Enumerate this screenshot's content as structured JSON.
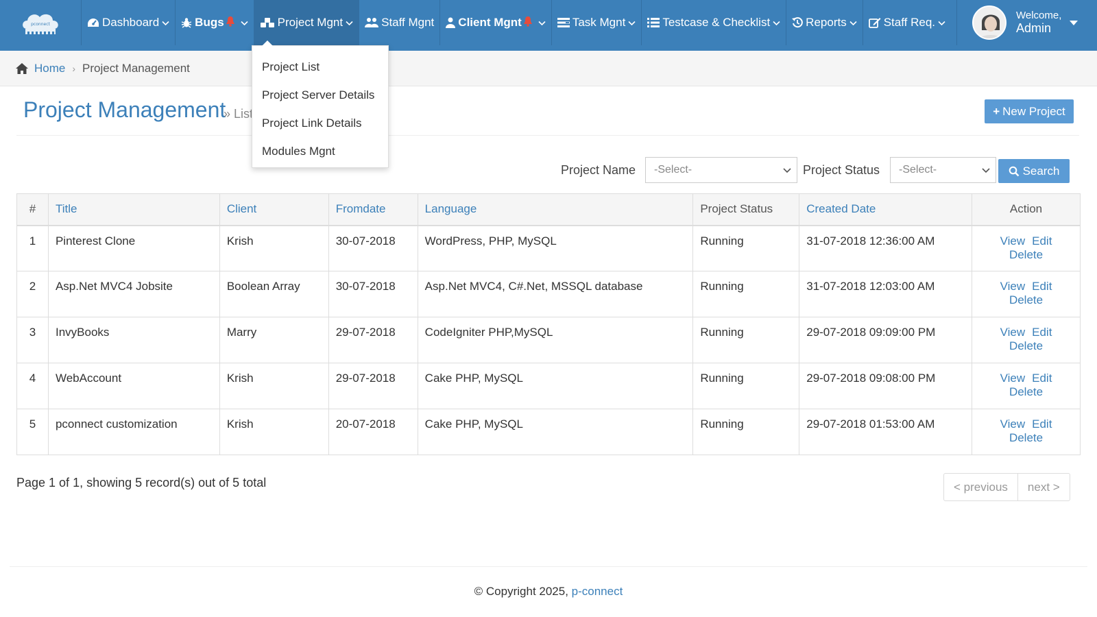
{
  "colors": {
    "navbar": "#3c80b9",
    "accent": "#5b9bd5",
    "link": "#3c80b9",
    "alert": "#e74c3c"
  },
  "nav": {
    "items": [
      {
        "label": "Dashboard",
        "icon": "dashboard-icon"
      },
      {
        "label": "Bugs",
        "icon": "bug-icon",
        "alert": true
      },
      {
        "label": "Project Mgnt",
        "icon": "cubes-icon",
        "active": true
      },
      {
        "label": "Staff Mgnt",
        "icon": "users-icon"
      },
      {
        "label": "Client Mgnt",
        "icon": "user-icon",
        "alert": true
      },
      {
        "label": "Task Mgnt",
        "icon": "tasks-icon"
      },
      {
        "label": "Testcase & Checklist",
        "icon": "list-icon"
      },
      {
        "label": "Reports",
        "icon": "history-icon"
      },
      {
        "label": "Staff Req.",
        "icon": "edit-icon"
      }
    ],
    "welcome": "Welcome,",
    "user": "Admin"
  },
  "dropdown": {
    "items": [
      "Project List",
      "Project Server Details",
      "Project Link Details",
      "Modules Mgnt"
    ]
  },
  "breadcrumb": {
    "home": "Home",
    "current": "Project Management"
  },
  "page": {
    "title": "Project Management",
    "subtitle": "» List",
    "new_button": "New Project"
  },
  "filters": {
    "project_name_label": "Project Name",
    "project_name_value": "-Select-",
    "project_status_label": "Project Status",
    "project_status_value": "-Select-",
    "search_button": "Search"
  },
  "table": {
    "columns": [
      "#",
      "Title",
      "Client",
      "Fromdate",
      "Language",
      "Project Status",
      "Created Date",
      "Action"
    ],
    "rows": [
      [
        "1",
        "Pinterest Clone",
        "Krish",
        "30-07-2018",
        "WordPress, PHP, MySQL",
        "Running",
        "31-07-2018 12:36:00 AM"
      ],
      [
        "2",
        "Asp.Net MVC4 Jobsite",
        "Boolean Array",
        "30-07-2018",
        "Asp.Net MVC4, C#.Net, MSSQL database",
        "Running",
        "31-07-2018 12:03:00 AM"
      ],
      [
        "3",
        "InvyBooks",
        "Marry",
        "29-07-2018",
        "CodeIgniter PHP,MySQL",
        "Running",
        "29-07-2018 09:09:00 PM"
      ],
      [
        "4",
        "WebAccount",
        "Krish",
        "29-07-2018",
        "Cake PHP, MySQL",
        "Running",
        "29-07-2018 09:08:00 PM"
      ],
      [
        "5",
        "pconnect customization",
        "Krish",
        "20-07-2018",
        "Cake PHP, MySQL",
        "Running",
        "29-07-2018 01:53:00 AM"
      ]
    ],
    "actions": {
      "view": "View",
      "edit": "Edit",
      "delete": "Delete"
    }
  },
  "pagination": {
    "info": "Page 1 of 1, showing 5 record(s) out of 5 total",
    "previous": "< previous",
    "next": "next >"
  },
  "footer": {
    "copyright": "© Copyright 2025, ",
    "brand": "p-connect"
  }
}
